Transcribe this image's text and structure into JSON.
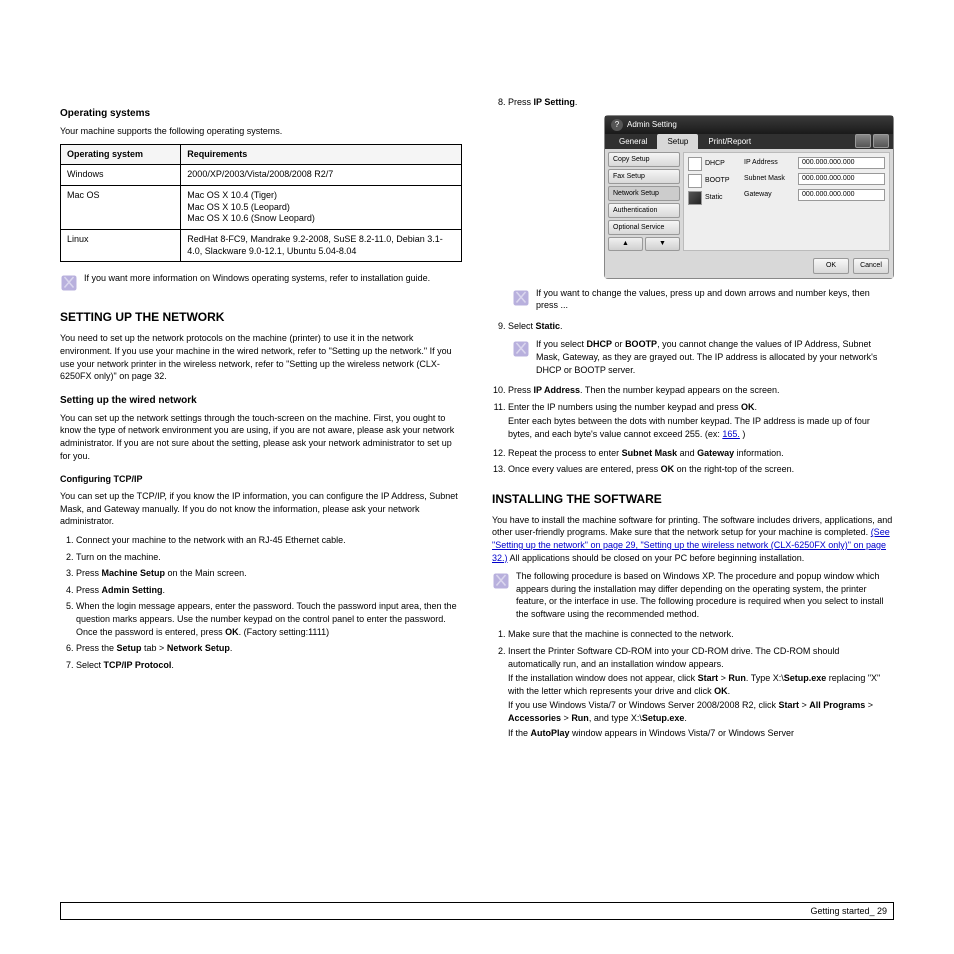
{
  "left": {
    "heading": "Operating systems",
    "intro": "Your machine supports the following operating systems.",
    "table": {
      "header": [
        "Operating system",
        "Requirements"
      ],
      "rows": [
        [
          "Windows",
          "2000/XP/2003/Vista/2008/2008 R2/7"
        ],
        [
          "Mac OS",
          "Mac OS X 10.4 (Tiger)\nMac OS X 10.5 (Leopard)\nMac OS X 10.6 (Snow Leopard)"
        ],
        [
          "Linux",
          "RedHat 8-FC9, Mandrake 9.2-2008, SuSE 8.2-11.0, Debian 3.1-4.0, Slackware 9.0-12.1, Ubuntu 5.04-8.04"
        ]
      ]
    },
    "note1_a": "If you want more information on Windows operating systems, refer to installation guide.",
    "note1_b": " ",
    "h2": "SETTING UP THE NETWORK",
    "setupIntro": "You need to set up the network protocols on the machine (printer) to use it in the network environment. If you use your machine in the wired network, refer to \"Setting up the network.\" If you use your network printer in the wireless network, refer to \"Setting up the wireless network (CLX-6250FX only)\" on page 32.",
    "h3": "Setting up the wired network",
    "wiredIntro": "You can set up the network settings through the touch-screen on the machine. First, you ought to know the type of network environment you are using, if you are not aware, please ask your network administrator. If you are not sure about the setting, please ask your network administrator to set up for you.",
    "configHeading": "Configuring TCP/IP",
    "configIntro": "You can set up the TCP/IP, if you know the IP information, you can configure the IP Address, Subnet Mask, and Gateway manually. If you do not know the information, please ask your network administrator.",
    "step1": "Connect your machine to the network with an RJ-45 Ethernet cable.",
    "step2": "Turn on the machine.",
    "step3a": "Press ",
    "step3b": "Machine Setup",
    "step3c": " on the Main screen.",
    "step4a": "Press ",
    "step4b": "Admin Setting",
    "step4c": ".",
    "step5a": "When the login message appears, enter the password. Touch the password input area, then the question marks appears. Use the number keypad on the control panel to enter the password. Once the password is entered, press ",
    "step5b": "OK",
    "step5c": ". (Factory setting:1111)",
    "step6a": "Press the ",
    "step6b": "Setup",
    "step6c": " tab > ",
    "step6d": "Network Setup",
    "step6e": ".",
    "step7a": "Select ",
    "step7b": "TCP/IP Protocol",
    "step7c": "."
  },
  "right": {
    "step8a": "Press ",
    "step8b": "IP Setting",
    "step8c": ".",
    "note2": "If you want to change the values, press up and down arrows and number keys, then press ...",
    "step9a": "Select ",
    "step9b": "Static",
    "step9c": ".",
    "note3a": "If you select ",
    "note3b": "DHCP",
    "note3c": " or ",
    "note3d": "BOOTP",
    "note3e": ", you cannot change the values of IP Address, Subnet Mask, Gateway, as they are grayed out. The IP address is allocated by your network's DHCP or BOOTP server.",
    "step10a": "Press ",
    "step10b": "IP Address",
    "step10c": ". Then the number keypad appears on the screen.",
    "step11a": "Enter the IP numbers using the number keypad and press ",
    "step11b": "OK",
    "step11c": ".",
    "note4a": "Enter each bytes between the dots with number keypad. The IP address is made up of four bytes, and each byte's value cannot exceed 255. (ex:",
    "note4b": "165.",
    "note4c": " )",
    "step12a": "Repeat the process to enter ",
    "step12b": "Subnet Mask",
    "step12c": " and ",
    "step12d": "Gateway",
    "step12e": " information.",
    "step13a": "Once every values are entered, press ",
    "step13b": "OK",
    "step13c": " on the right-top of the screen.",
    "h2": "INSTALLING THE SOFTWARE",
    "installIntro1": "You have to install the machine software for printing. The software includes drivers, applications, and other user-friendly programs. Make sure that the network setup for your machine is completed.",
    "installIntro1a": " (See \"Setting up the network\" on page 29, \"Setting up the wireless network (CLX-6250FX only)\" on page 32.)",
    "installIntro2": " All applications should be closed on your PC before beginning installation.",
    "note5": "The following procedure is based on Windows XP. The procedure and popup window which appears during the installation may differ depending on the operating system, the printer feature, or the interface in use. The following procedure is required when you select to install the software using the recommended method.",
    "step_r1": "Make sure that the machine is connected to the network.",
    "step_r2": "Insert the Printer Software CD-ROM into your CD-ROM drive. The CD-ROM should automatically run, and an installation window appears.",
    "ifnot": " If the installation window does not appear, click ",
    "ifnot_b1": "Start",
    "ifnot_c": " > ",
    "ifnot_b2": "Run",
    "ifnot_d": ". Type X:\\",
    "ifnot_b3": "Setup.exe",
    "ifnot_e": " replacing \"X\" with the letter which represents your drive and click ",
    "ifnot_b4": "OK",
    "ifnot_f": ".",
    "vista_a": "If you use Windows Vista/7 or Windows Server 2008/2008 R2, click ",
    "vista_b1": "Start",
    "vista_c": " > ",
    "vista_b2": "All Programs",
    "vista_d": " > ",
    "vista_b3": "Accessories",
    "vista_e": " > ",
    "vista_b4": "Run",
    "vista_f": ", and type X:\\",
    "vista_b5": "Setup.exe",
    "vista_g": ".",
    "autoplay_a": "If the ",
    "autoplay_b": "AutoPlay",
    "autoplay_c": " window appears in Windows Vista/7 or Windows Server"
  },
  "dialog": {
    "title": "Admin Setting",
    "tabs": [
      "General",
      "Setup",
      "Print/Report"
    ],
    "sidebar": [
      "Copy Setup",
      "Fax Setup",
      "Network Setup",
      "Authentication",
      "Optional Service"
    ],
    "modes": [
      "DHCP",
      "BOOTP",
      "Static"
    ],
    "fields": {
      "ipLabel": "IP Address",
      "ipVal": "000.000.000.000",
      "maskLabel": "Subnet Mask",
      "maskVal": "000.000.000.000",
      "gwLabel": "Gateway",
      "gwVal": "000.000.000.000"
    },
    "ok": "OK",
    "cancel": "Cancel"
  },
  "footer": {
    "right": "Getting started_ 29"
  }
}
